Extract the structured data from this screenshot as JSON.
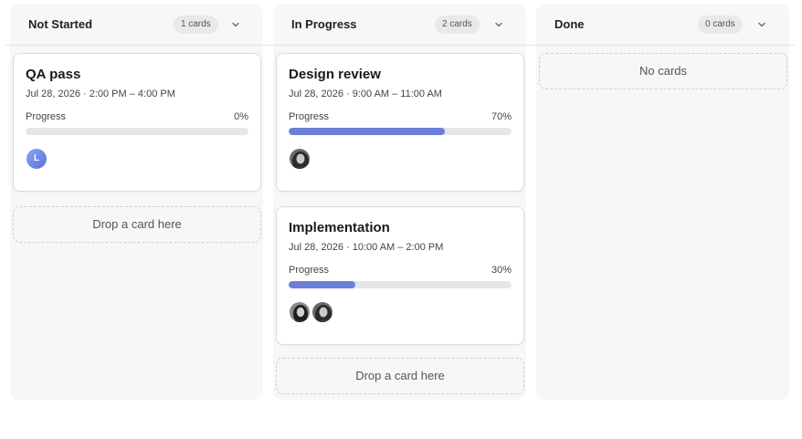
{
  "columns": [
    {
      "title": "Not Started",
      "count_label": "1 cards",
      "cards": [
        {
          "title": "QA pass",
          "time": "Jul 28, 2026 · 2:00 PM – 4:00 PM",
          "progress_label": "Progress",
          "progress_text": "0%",
          "progress": 0,
          "avatars": [
            {
              "kind": "initial",
              "text": "L"
            }
          ]
        }
      ],
      "dropzone_label": "Drop a card here"
    },
    {
      "title": "In Progress",
      "count_label": "2 cards",
      "cards": [
        {
          "title": "Design review",
          "time": "Jul 28, 2026 · 9:00 AM – 11:00 AM",
          "progress_label": "Progress",
          "progress_text": "70%",
          "progress": 0.7,
          "avatars": [
            {
              "kind": "photo"
            }
          ]
        },
        {
          "title": "Implementation",
          "time": "Jul 28, 2026 · 10:00 AM – 2:00 PM",
          "progress_label": "Progress",
          "progress_text": "30%",
          "progress": 0.3,
          "avatars": [
            {
              "kind": "photo"
            },
            {
              "kind": "photo"
            }
          ]
        }
      ],
      "dropzone_label": "Drop a card here"
    },
    {
      "title": "Done",
      "count_label": "0 cards",
      "cards": [],
      "empty_label": "No cards"
    }
  ],
  "colors": {
    "progress_fill": "#6b7fd7",
    "progress_track": "#e6e6e8",
    "column_bg": "#f7f7f8"
  },
  "icons": {
    "collapse": "chevron-down-icon"
  }
}
